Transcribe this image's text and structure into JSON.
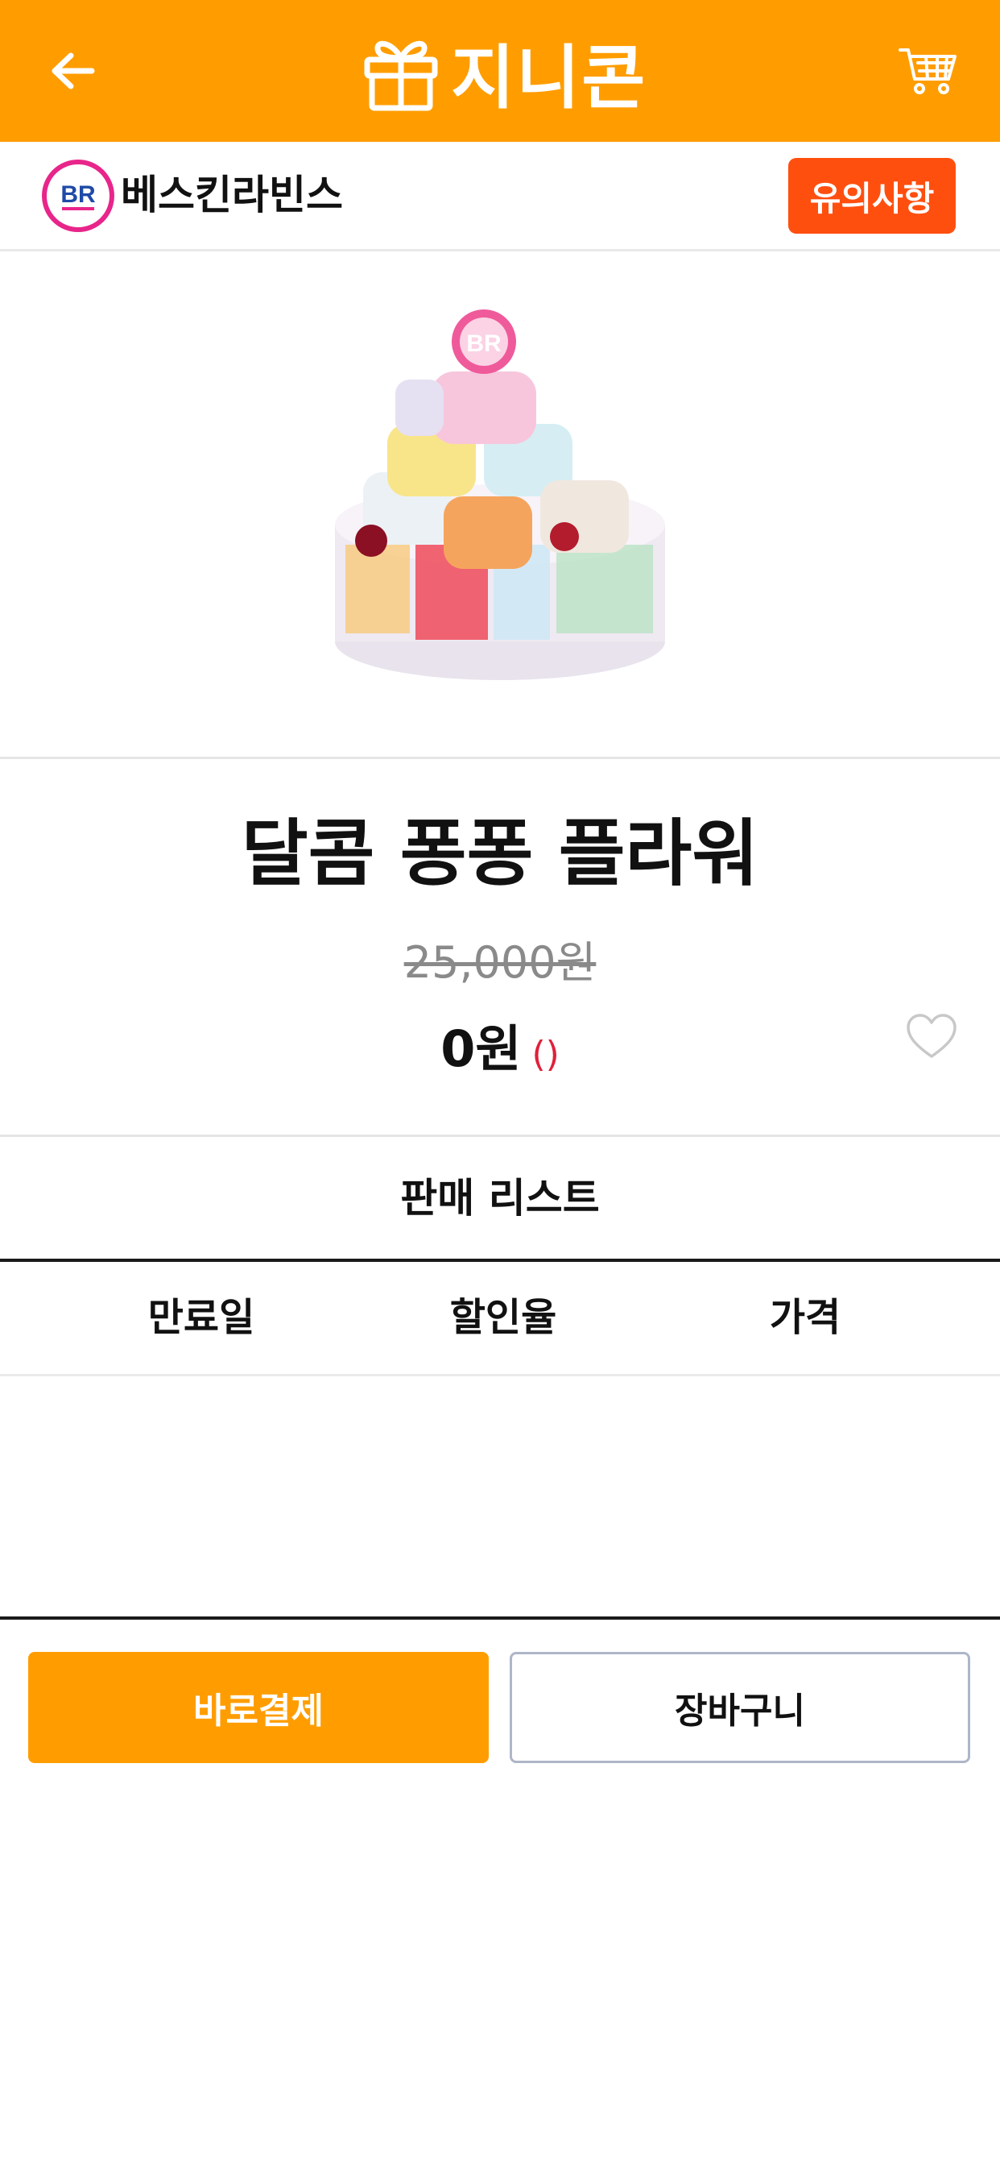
{
  "header": {
    "logo_text": "지니콘",
    "back_icon": "arrow-left-icon",
    "cart_icon": "cart-icon",
    "logo_icon": "gift-box-icon",
    "background_color": "#ff9d00"
  },
  "brand": {
    "name": "베스킨라빈스",
    "logo_text": "BR",
    "notice_button": "유의사항",
    "notice_color": "#ff4f0f"
  },
  "product": {
    "title": "달콤 퐁퐁 플라워",
    "original_price": "25,000원",
    "sale_price": "0원",
    "sale_extra": "()",
    "wishlist_icon": "heart-outline-icon"
  },
  "sale_list": {
    "title": "판매 리스트",
    "columns": [
      "만료일",
      "할인율",
      "가격"
    ],
    "rows": []
  },
  "actions": {
    "buy_now": "바로결제",
    "add_to_cart": "장바구니"
  }
}
